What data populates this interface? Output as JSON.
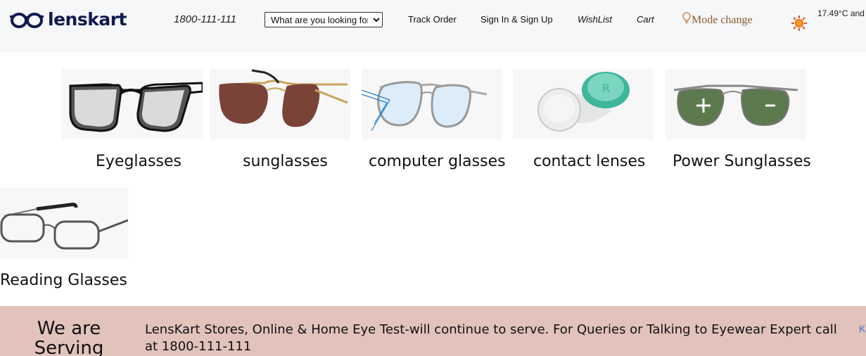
{
  "header": {
    "logo_text": "lenskart",
    "phone": "1800-111-111",
    "search_placeholder": "What are you looking for",
    "nav": {
      "track_order": "Track Order",
      "sign_in": "Sign In & Sign Up",
      "wishlist": "WishList",
      "cart": "Cart",
      "mode_change": "Mode change"
    },
    "weather_text": "17.49°C and",
    "icons": {
      "logo": "glasses-logo-icon",
      "mode": "lightbulb-icon",
      "weather": "sun-icon"
    }
  },
  "categories": [
    {
      "label": "Eyeglasses",
      "icon": "eyeglasses-icon"
    },
    {
      "label": "sunglasses",
      "icon": "aviator-sunglasses-icon"
    },
    {
      "label": "computer glasses",
      "icon": "computer-glasses-icon"
    },
    {
      "label": "contact lenses",
      "icon": "contact-lens-case-icon"
    },
    {
      "label": "Power Sunglasses",
      "icon": "power-sunglasses-icon"
    },
    {
      "label": "Reading Glasses",
      "icon": "reading-glasses-icon"
    }
  ],
  "banner": {
    "title": "We are Serving",
    "message": "LensKart Stores, Online & Home Eye Test-will continue to serve. For Queries or Talking to Eyewear Expert call at 1800-111-111",
    "edge_text": "K"
  },
  "colors": {
    "header_bg": "#f6f7f9",
    "logo": "#0f1a4f",
    "mode_text": "#8a5a2b",
    "banner_bg": "#e1c3bb",
    "banner_link": "#3a6fd1"
  }
}
